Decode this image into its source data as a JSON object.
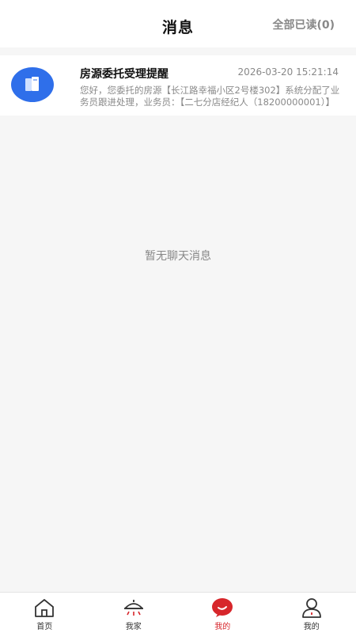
{
  "header": {
    "title": "消息",
    "mark_all_read": "全部已读(0)"
  },
  "message": {
    "title": "房源委托受理提醒",
    "time": "2026-03-20 15:21:14",
    "content": "您好，您委托的房源【长江路幸福小区2号楼302】系统分配了业务员跟进处理，业务员：【二七分店经纪人（18200000001）】",
    "icon": "building-icon"
  },
  "empty": {
    "text": "暂无聊天消息"
  },
  "tabbar": {
    "items": [
      {
        "label": "首页",
        "icon": "home-icon"
      },
      {
        "label": "我家",
        "icon": "lamp-icon"
      },
      {
        "label": "我的",
        "icon": "chat-bubble-icon",
        "active": true
      },
      {
        "label": "我的",
        "icon": "user-icon"
      }
    ]
  },
  "colors": {
    "accent": "#d7262b",
    "avatar_blue": "#2f6fea"
  }
}
